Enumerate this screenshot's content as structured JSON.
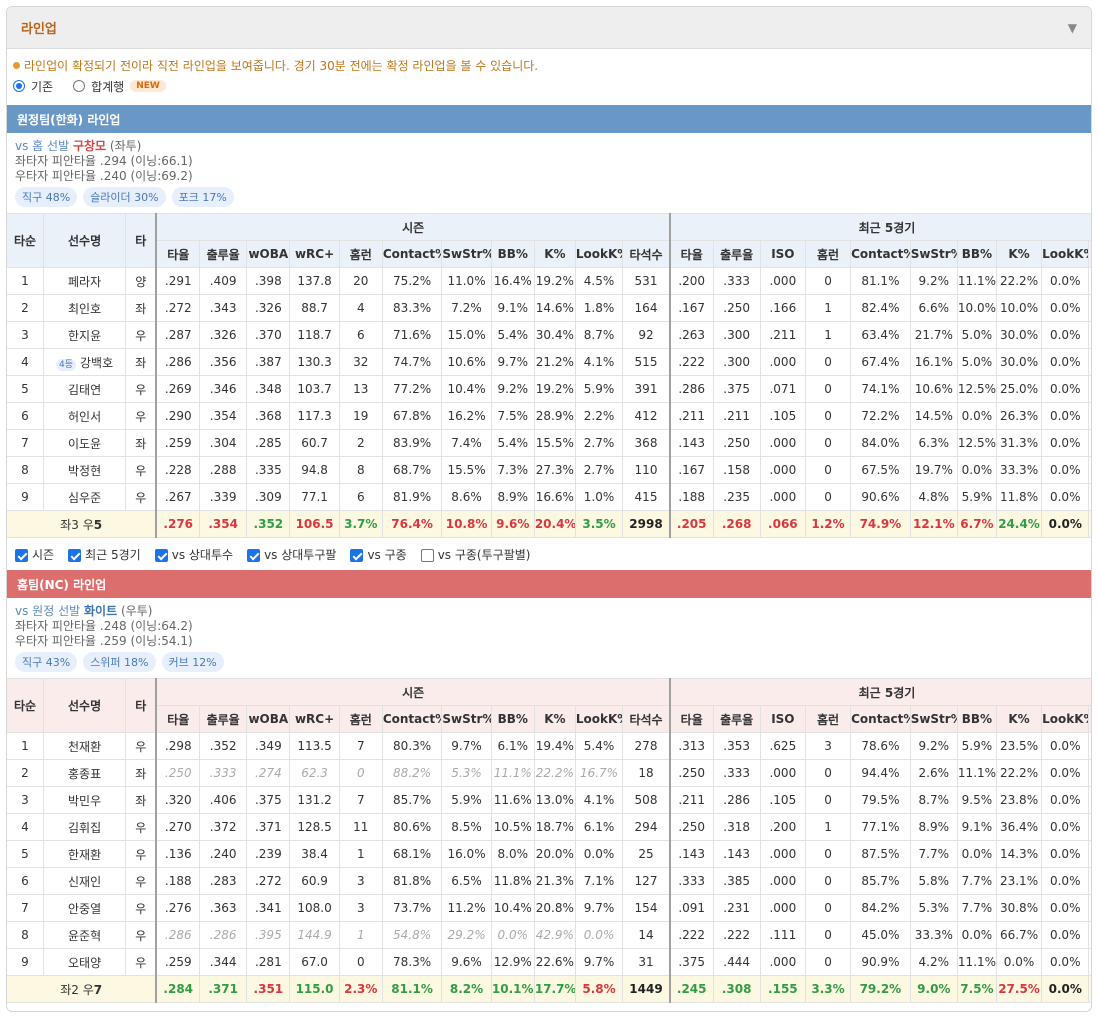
{
  "panel": {
    "title": "라인업",
    "notice": "라인업이 확정되기 전이라 직전 라인업을 보여줍니다. 경기 30분 전에는 확정 라인업을 볼 수 있습니다.",
    "radio_basic": "기존",
    "radio_total": "합계행",
    "new_badge": "NEW"
  },
  "colors": {
    "away_bar": "#6a98c6",
    "home_bar": "#dd6e6e",
    "red": "#d9363e",
    "green": "#2f9e44",
    "accent": "#b8651b"
  },
  "headers": {
    "order": "타순",
    "player": "선수명",
    "bat": "타",
    "season": "시즌",
    "recent": "최근 5경기",
    "season_cols": [
      "타율",
      "출루율",
      "wOBA",
      "wRC+",
      "홈런",
      "Contact%",
      "SwStr%",
      "BB%",
      "K%",
      "LookK%",
      "타석수"
    ],
    "recent_cols": [
      "타율",
      "출루율",
      "ISO",
      "홈런",
      "Contact%",
      "SwStr%",
      "BB%",
      "K%",
      "LookK%"
    ]
  },
  "away": {
    "bar": "원정팀(한화) 라인업",
    "vs_prefix": "vs 홈 선발",
    "pitcher": "구창모",
    "hand": "(좌투)",
    "left_line": "좌타자 피안타율 .294 (이닝:66.1)",
    "right_line": "우타자 피안타율 .240 (이닝:69.2)",
    "pitches": [
      "직구 48%",
      "슬라이더 30%",
      "포크 17%"
    ],
    "rows": [
      {
        "o": "1",
        "name": "페라자",
        "bat": "양",
        "s": [
          ".291",
          ".409",
          ".398",
          "137.8",
          "20",
          "75.2%",
          "11.0%",
          "16.4%",
          "19.2%",
          "4.5%",
          "531"
        ],
        "r": [
          ".200",
          ".333",
          ".000",
          "0",
          "81.1%",
          "9.2%",
          "11.1%",
          "22.2%",
          "0.0%"
        ]
      },
      {
        "o": "2",
        "name": "최인호",
        "bat": "좌",
        "s": [
          ".272",
          ".343",
          ".326",
          "88.7",
          "4",
          "83.3%",
          "7.2%",
          "9.1%",
          "14.6%",
          "1.8%",
          "164"
        ],
        "r": [
          ".167",
          ".250",
          ".166",
          "1",
          "82.4%",
          "6.6%",
          "10.0%",
          "10.0%",
          "0.0%"
        ]
      },
      {
        "o": "3",
        "name": "한지윤",
        "bat": "우",
        "s": [
          ".287",
          ".326",
          ".370",
          "118.7",
          "6",
          "71.6%",
          "15.0%",
          "5.4%",
          "30.4%",
          "8.7%",
          "92"
        ],
        "r": [
          ".263",
          ".300",
          ".211",
          "1",
          "63.4%",
          "21.7%",
          "5.0%",
          "30.0%",
          "0.0%"
        ]
      },
      {
        "o": "4",
        "badge": "4등",
        "name": "강백호",
        "bat": "좌",
        "s": [
          ".286",
          ".356",
          ".387",
          "130.3",
          "32",
          "74.7%",
          "10.6%",
          "9.7%",
          "21.2%",
          "4.1%",
          "515"
        ],
        "r": [
          ".222",
          ".300",
          ".000",
          "0",
          "67.4%",
          "16.1%",
          "5.0%",
          "30.0%",
          "0.0%"
        ]
      },
      {
        "o": "5",
        "name": "김태연",
        "bat": "우",
        "s": [
          ".269",
          ".346",
          ".348",
          "103.7",
          "13",
          "77.2%",
          "10.4%",
          "9.2%",
          "19.2%",
          "5.9%",
          "391"
        ],
        "r": [
          ".286",
          ".375",
          ".071",
          "0",
          "74.1%",
          "10.6%",
          "12.5%",
          "25.0%",
          "0.0%"
        ]
      },
      {
        "o": "6",
        "name": "허인서",
        "bat": "우",
        "s": [
          ".290",
          ".354",
          ".368",
          "117.3",
          "19",
          "67.8%",
          "16.2%",
          "7.5%",
          "28.9%",
          "2.2%",
          "412"
        ],
        "r": [
          ".211",
          ".211",
          ".105",
          "0",
          "72.2%",
          "14.5%",
          "0.0%",
          "26.3%",
          "0.0%"
        ]
      },
      {
        "o": "7",
        "name": "이도윤",
        "bat": "좌",
        "s": [
          ".259",
          ".304",
          ".285",
          "60.7",
          "2",
          "83.9%",
          "7.4%",
          "5.4%",
          "15.5%",
          "2.7%",
          "368"
        ],
        "r": [
          ".143",
          ".250",
          ".000",
          "0",
          "84.0%",
          "6.3%",
          "12.5%",
          "31.3%",
          "0.0%"
        ]
      },
      {
        "o": "8",
        "name": "박정현",
        "bat": "우",
        "s": [
          ".228",
          ".288",
          ".335",
          "94.8",
          "8",
          "68.7%",
          "15.5%",
          "7.3%",
          "27.3%",
          "2.7%",
          "110"
        ],
        "r": [
          ".167",
          ".158",
          ".000",
          "0",
          "67.5%",
          "19.7%",
          "0.0%",
          "33.3%",
          "0.0%"
        ]
      },
      {
        "o": "9",
        "name": "심우준",
        "bat": "우",
        "s": [
          ".267",
          ".339",
          ".309",
          "77.1",
          "6",
          "81.9%",
          "8.6%",
          "8.9%",
          "16.6%",
          "1.0%",
          "415"
        ],
        "r": [
          ".188",
          ".235",
          ".000",
          "0",
          "90.6%",
          "4.8%",
          "5.9%",
          "11.8%",
          "0.0%"
        ]
      }
    ],
    "sum_label_a": "좌3 우",
    "sum_label_b": "5",
    "sum_s": [
      ".276",
      ".354",
      ".352",
      "106.5",
      "3.7%",
      "76.4%",
      "10.8%",
      "9.6%",
      "20.4%",
      "3.5%",
      "2998"
    ],
    "sum_s_c": [
      "r",
      "r",
      "g",
      "r",
      "g",
      "r",
      "r",
      "r",
      "r",
      "g",
      "k"
    ],
    "sum_r": [
      ".205",
      ".268",
      ".066",
      "1.2%",
      "74.9%",
      "12.1%",
      "6.7%",
      "24.4%",
      "0.0%"
    ],
    "sum_r_c": [
      "r",
      "r",
      "r",
      "r",
      "r",
      "r",
      "r",
      "g",
      "k"
    ]
  },
  "checks": [
    "시즌",
    "최근 5경기",
    "vs 상대투수",
    "vs 상대투구팔",
    "vs 구종",
    "vs 구종(투구팔별)"
  ],
  "checks_on": [
    true,
    true,
    true,
    true,
    true,
    false
  ],
  "home": {
    "bar": "홈팀(NC) 라인업",
    "vs_prefix": "vs 원정 선발",
    "pitcher": "화이트",
    "hand": "(우투)",
    "left_line": "좌타자 피안타율 .248 (이닝:64.2)",
    "right_line": "우타자 피안타율 .259 (이닝:54.1)",
    "pitches": [
      "직구 43%",
      "스위퍼 18%",
      "커브 12%"
    ],
    "rows": [
      {
        "o": "1",
        "name": "천재환",
        "bat": "우",
        "s": [
          ".298",
          ".352",
          ".349",
          "113.5",
          "7",
          "80.3%",
          "9.7%",
          "6.1%",
          "19.4%",
          "5.4%",
          "278"
        ],
        "r": [
          ".313",
          ".353",
          ".625",
          "3",
          "78.6%",
          "9.2%",
          "5.9%",
          "23.5%",
          "0.0%"
        ]
      },
      {
        "o": "2",
        "name": "홍종표",
        "bat": "좌",
        "gray": true,
        "s": [
          ".250",
          ".333",
          ".274",
          "62.3",
          "0",
          "88.2%",
          "5.3%",
          "11.1%",
          "22.2%",
          "16.7%",
          "18"
        ],
        "r": [
          ".250",
          ".333",
          ".000",
          "0",
          "94.4%",
          "2.6%",
          "11.1%",
          "22.2%",
          "0.0%"
        ]
      },
      {
        "o": "3",
        "name": "박민우",
        "bat": "좌",
        "s": [
          ".320",
          ".406",
          ".375",
          "131.2",
          "7",
          "85.7%",
          "5.9%",
          "11.6%",
          "13.0%",
          "4.1%",
          "508"
        ],
        "r": [
          ".211",
          ".286",
          ".105",
          "0",
          "79.5%",
          "8.7%",
          "9.5%",
          "23.8%",
          "0.0%"
        ]
      },
      {
        "o": "4",
        "name": "김휘집",
        "bat": "우",
        "s": [
          ".270",
          ".372",
          ".371",
          "128.5",
          "11",
          "80.6%",
          "8.5%",
          "10.5%",
          "18.7%",
          "6.1%",
          "294"
        ],
        "r": [
          ".250",
          ".318",
          ".200",
          "1",
          "77.1%",
          "8.9%",
          "9.1%",
          "36.4%",
          "0.0%"
        ]
      },
      {
        "o": "5",
        "name": "한재환",
        "bat": "우",
        "s": [
          ".136",
          ".240",
          ".239",
          "38.4",
          "1",
          "68.1%",
          "16.0%",
          "8.0%",
          "20.0%",
          "0.0%",
          "25"
        ],
        "r": [
          ".143",
          ".143",
          ".000",
          "0",
          "87.5%",
          "7.7%",
          "0.0%",
          "14.3%",
          "0.0%"
        ]
      },
      {
        "o": "6",
        "name": "신재인",
        "bat": "우",
        "s": [
          ".188",
          ".283",
          ".272",
          "60.9",
          "3",
          "81.8%",
          "6.5%",
          "11.8%",
          "21.3%",
          "7.1%",
          "127"
        ],
        "r": [
          ".333",
          ".385",
          ".000",
          "0",
          "85.7%",
          "5.8%",
          "7.7%",
          "23.1%",
          "0.0%"
        ]
      },
      {
        "o": "7",
        "name": "안중열",
        "bat": "우",
        "s": [
          ".276",
          ".363",
          ".341",
          "108.0",
          "3",
          "73.7%",
          "11.2%",
          "10.4%",
          "20.8%",
          "9.7%",
          "154"
        ],
        "r": [
          ".091",
          ".231",
          ".000",
          "0",
          "84.2%",
          "5.3%",
          "7.7%",
          "30.8%",
          "0.0%"
        ]
      },
      {
        "o": "8",
        "name": "윤준혁",
        "bat": "우",
        "gray": true,
        "s": [
          ".286",
          ".286",
          ".395",
          "144.9",
          "1",
          "54.8%",
          "29.2%",
          "0.0%",
          "42.9%",
          "0.0%",
          "14"
        ],
        "r": [
          ".222",
          ".222",
          ".111",
          "0",
          "45.0%",
          "33.3%",
          "0.0%",
          "66.7%",
          "0.0%"
        ]
      },
      {
        "o": "9",
        "name": "오태양",
        "bat": "우",
        "s": [
          ".259",
          ".344",
          ".281",
          "67.0",
          "0",
          "78.3%",
          "9.6%",
          "12.9%",
          "22.6%",
          "9.7%",
          "31"
        ],
        "r": [
          ".375",
          ".444",
          ".000",
          "0",
          "90.9%",
          "4.2%",
          "11.1%",
          "0.0%",
          "0.0%"
        ]
      }
    ],
    "sum_label_a": "좌2 우",
    "sum_label_b": "7",
    "sum_s": [
      ".284",
      ".371",
      ".351",
      "115.0",
      "2.3%",
      "81.1%",
      "8.2%",
      "10.1%",
      "17.7%",
      "5.8%",
      "1449"
    ],
    "sum_s_c": [
      "g",
      "g",
      "r",
      "g",
      "r",
      "g",
      "g",
      "g",
      "g",
      "r",
      "k"
    ],
    "sum_r": [
      ".245",
      ".308",
      ".155",
      "3.3%",
      "79.2%",
      "9.0%",
      "7.5%",
      "27.5%",
      "0.0%"
    ],
    "sum_r_c": [
      "g",
      "g",
      "g",
      "g",
      "g",
      "g",
      "g",
      "r",
      "k"
    ]
  }
}
